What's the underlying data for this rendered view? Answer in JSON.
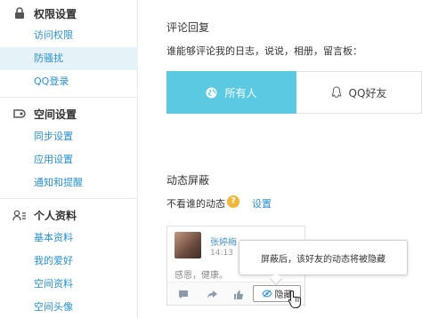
{
  "sidebar": {
    "sections": [
      {
        "title": "权限设置",
        "icon": "lock-icon",
        "items": [
          "访问权限",
          "防骚扰",
          "QQ登录"
        ]
      },
      {
        "title": "空间设置",
        "icon": "settings-icon",
        "items": [
          "同步设置",
          "应用设置",
          "通知和提醒"
        ]
      },
      {
        "title": "个人资料",
        "icon": "profile-card-icon",
        "items": [
          "基本资料",
          "我的爱好",
          "空间资料",
          "空间头像"
        ]
      }
    ],
    "active_item": "防骚扰"
  },
  "comment_reply": {
    "title": "评论回复",
    "question": "谁能够评论我的日志，说说，相册，留言板：",
    "options": [
      {
        "label": "所有人",
        "icon": "globe-icon",
        "selected": true
      },
      {
        "label": "QQ好友",
        "icon": "qq-penguin-icon",
        "selected": false
      }
    ]
  },
  "feed_block": {
    "title": "动态屏蔽",
    "question": "不看谁的动态",
    "help_symbol": "?",
    "settings_link": "设置"
  },
  "feed_card": {
    "name": "张婷梅",
    "time": "14:13",
    "content": "感恩，健康。",
    "hide_label": "隐藏",
    "tooltip": "屏蔽后，该好友的动态将被隐藏"
  },
  "colors": {
    "link": "#2a8fd0",
    "selected_option": "#5bc9e2",
    "active_nav_bg": "#e5f2f8",
    "help_badge": "#f0b63a"
  }
}
